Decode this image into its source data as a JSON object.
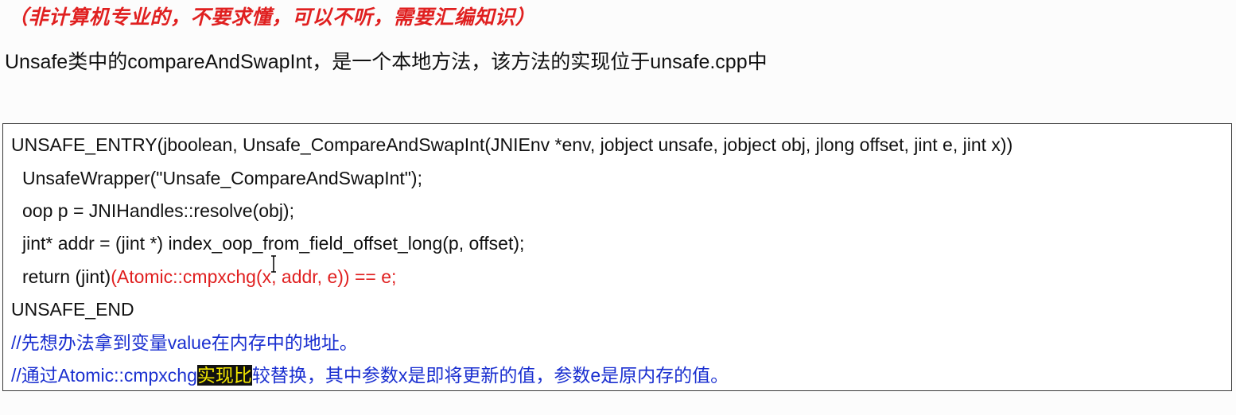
{
  "warning_note": "（非计算机专业的，不要求懂，可以不听，需要汇编知识）",
  "intro": "Unsafe类中的compareAndSwapInt，是一个本地方法，该方法的实现位于unsafe.cpp中",
  "code": {
    "line1": "UNSAFE_ENTRY(jboolean, Unsafe_CompareAndSwapInt(JNIEnv *env, jobject unsafe, jobject obj, jlong offset, jint e, jint x))",
    "line2": "UnsafeWrapper(\"Unsafe_CompareAndSwapInt\");",
    "line3": "oop p = JNIHandles::resolve(obj);",
    "line4": "jint* addr = (jint *) index_oop_from_field_offset_long(p, offset);",
    "line5_prefix": "return (jint)",
    "line5_highlight": "(Atomic::cmpxchg(x, addr, e)) == e;",
    "line6": "UNSAFE_END"
  },
  "comments": {
    "comment1": "//先想办法拿到变量value在内存中的地址。",
    "comment2_prefix": "//通过Atomic::cmpxchg",
    "comment2_selected": "实现比",
    "comment2_suffix": "较替换，其中参数x是即将更新的值，参数e是原内存的值。"
  },
  "colors": {
    "warning": "#e02020",
    "comment": "#1a2fd0",
    "selection_bg": "#111111",
    "selection_fg": "#f2e600"
  },
  "icons": {
    "cursor": "text-cursor-icon"
  }
}
